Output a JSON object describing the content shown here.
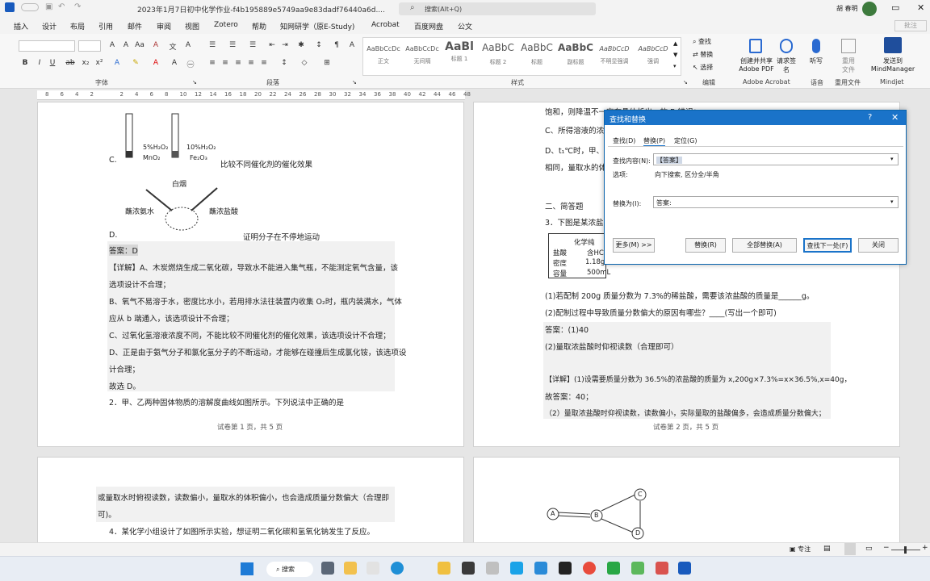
{
  "titlebar": {
    "doc_title": "2023年1月7日初中化学作业-f4b195889e5749aa9e83dadf76440a6d....",
    "search_placeholder": "搜索(Alt+Q)",
    "user": "胡 春明"
  },
  "menu": [
    "插入",
    "设计",
    "布局",
    "引用",
    "邮件",
    "审阅",
    "视图",
    "Zotero",
    "帮助",
    "知网研学（原E-Study)",
    "Acrobat",
    "百度网盘",
    "公文"
  ],
  "share_label": "批注",
  "ribbon": {
    "groups": {
      "font": "字体",
      "paragraph": "段落",
      "styles": "样式",
      "editing": "编辑",
      "acrobat": "Adobe Acrobat",
      "voice": "语音",
      "reuse": "重用文件",
      "mindjet": "Mindjet"
    },
    "styles": [
      {
        "preview": "AaBbCcDc",
        "name": "正文"
      },
      {
        "preview": "AaBbCcDc",
        "name": "无间隔"
      },
      {
        "preview": "AaBl",
        "name": "标题 1"
      },
      {
        "preview": "AaBbC",
        "name": "标题 2"
      },
      {
        "preview": "AaBbC",
        "name": "标题"
      },
      {
        "preview": "AaBbC",
        "name": "副标题"
      },
      {
        "preview": "AaBbCcD",
        "name": "不明显强调"
      },
      {
        "preview": "AaBbCcD",
        "name": "强调"
      }
    ],
    "find": "查找",
    "replace": "替换",
    "select": "选择",
    "create_pdf": "创建并共享 Adobe PDF",
    "request_sign": "请求签名",
    "dictate": "听写",
    "reuse_file": "重用文件",
    "send_mindmanager": "发送到 MindManager"
  },
  "ruler_left": [
    "8",
    "6",
    "4",
    "2",
    "",
    "2",
    "4",
    "6",
    "8",
    "10",
    "12",
    "14",
    "16",
    "18",
    "20",
    "22",
    "24",
    "26",
    "28",
    "30",
    "32",
    "34",
    "36",
    "38",
    "40",
    "42",
    "44",
    "46",
    "48"
  ],
  "page1": {
    "lines": [
      "C.",
      "5%H₂O₂",
      "MnO₂",
      "10%H₂O₂",
      "Fe₂O₃",
      "比较不同催化剂的催化效果",
      "白烟",
      "蘸浓氨水",
      "蘸浓盐酸",
      "D.",
      "证明分子在不停地运动",
      "答案：D",
      "【详解】A、木炭燃烧生成二氧化碳，导致水不能进入集气瓶，不能测定氧气含量，该",
      "选项设计不合理；",
      "B、氧气不易溶于水，密度比水小，若用排水法往装置内收集 O₂时，瓶内装满水，气体",
      "应从 b 端通入，该选项设计不合理；",
      "C、过氧化氢溶液浓度不同，不能比较不同催化剂的催化效果，该选项设计不合理；",
      "D、正是由于氨气分子和氯化氢分子的不断运动，才能够在碰撞后生成氯化铵，该选项设",
      "计合理；",
      "故选 D。",
      "2．甲、乙两种固体物质的溶解度曲线如图所示。下列说法中正确的是"
    ],
    "footer": "试卷第 1 页，共 5 页"
  },
  "page2": {
    "lines": [
      "饱和，则降温不一定有晶体析出，故 B 错误；",
      "C、所得溶液的浓",
      "D、t₁℃时，甲、乙",
      "相同，量取水的体",
      "二、简答题",
      "3．下图是某浓盐酸",
      "化学纯",
      "盐酸",
      "含HC",
      "密度",
      "1.18g/",
      "容量",
      "500mL",
      "(1)若配制 200g 质量分数为 7.3%的稀盐酸，需要该浓盐酸的质量是______g。",
      "(2)配制过程中导致质量分数偏大的原因有哪些？____(写出一个即可)",
      "答案：(1)40",
      "(2)量取浓盐酸时仰视读数（合理即可）",
      "【详解】(1)设需要质量分数为 36.5%的浓盐酸的质量为 x,200g×7.3%=x×36.5%,x=40g，",
      "故答案：40；",
      "（2）量取浓盐酸时仰视读数，读数偏小，实际量取的盐酸偏多，会造成质量分数偏大；"
    ],
    "footer": "试卷第 2 页，共 5 页"
  },
  "page3": {
    "lines": [
      "或量取水时俯视读数，读数偏小，量取水的体积偏小，也会造成质量分数偏大（合理即",
      "可)。",
      "4．某化学小组设计了如图所示实验，想证明二氧化碳和氢氧化钠发生了反应。"
    ]
  },
  "page4": {
    "nodes": [
      "A",
      "B",
      "C",
      "D"
    ]
  },
  "dialog": {
    "title": "查找和替换",
    "help": "?",
    "tabs": [
      "查找(D)",
      "替换(P)",
      "定位(G)"
    ],
    "find_label": "查找内容(N):",
    "find_value": "【答案】",
    "options_label": "选项:",
    "options_value": "向下搜索, 区分全/半角",
    "replace_label": "替换为(I):",
    "replace_value": "答案:",
    "buttons": [
      "更多(M) >>",
      "替换(R)",
      "全部替换(A)",
      "查找下一处(F)",
      "关闭"
    ]
  },
  "status": {
    "focus": "专注"
  },
  "taskbar": {
    "search": "搜索"
  }
}
